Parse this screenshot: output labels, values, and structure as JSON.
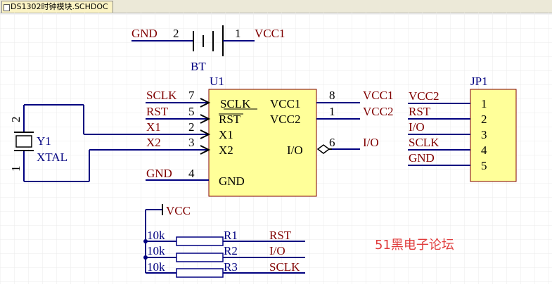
{
  "tab": {
    "title": "DS1302时钟模块.SCHDOC"
  },
  "battery": {
    "designator": "BT",
    "pin2": "2",
    "pin1": "1",
    "gnd_net": "GND",
    "vcc_net": "VCC1"
  },
  "u1": {
    "designator": "U1",
    "pins": {
      "sclk": {
        "num": "7",
        "name": "SCLK",
        "net": "SCLK"
      },
      "rst": {
        "num": "5",
        "name": "RST",
        "net": "RST"
      },
      "x1": {
        "num": "2",
        "name": "X1",
        "net": "X1"
      },
      "x2": {
        "num": "3",
        "name": "X2",
        "net": "X2"
      },
      "gnd": {
        "num": "4",
        "name": "GND",
        "net": "GND"
      },
      "vcc1": {
        "num": "8",
        "name": "VCC1",
        "net": "VCC1"
      },
      "vcc2": {
        "num": "1",
        "name": "VCC2",
        "net": "VCC2"
      },
      "io": {
        "num": "6",
        "name": "I/O",
        "net": "I/O"
      }
    }
  },
  "y1": {
    "designator": "Y1",
    "value": "XTAL",
    "pin_top": "2",
    "pin_bottom": "1"
  },
  "jp1": {
    "designator": "JP1",
    "pins": [
      {
        "num": "1",
        "net": "VCC2"
      },
      {
        "num": "2",
        "net": "RST"
      },
      {
        "num": "3",
        "net": "I/O"
      },
      {
        "num": "4",
        "net": "SCLK"
      },
      {
        "num": "5",
        "net": "GND"
      }
    ]
  },
  "pullups": {
    "power_net": "VCC",
    "resistors": [
      {
        "value": "10k",
        "designator": "R1",
        "net": "RST"
      },
      {
        "value": "10k",
        "designator": "R2",
        "net": "I/O"
      },
      {
        "value": "10k",
        "designator": "R3",
        "net": "SCLK"
      }
    ]
  },
  "watermark": "51黑电子论坛",
  "colors": {
    "wire": "#000080",
    "label": "#800000",
    "component_fill": "#ffff99",
    "grid": "#e8e8e8",
    "watermark": "#e03c3c"
  }
}
